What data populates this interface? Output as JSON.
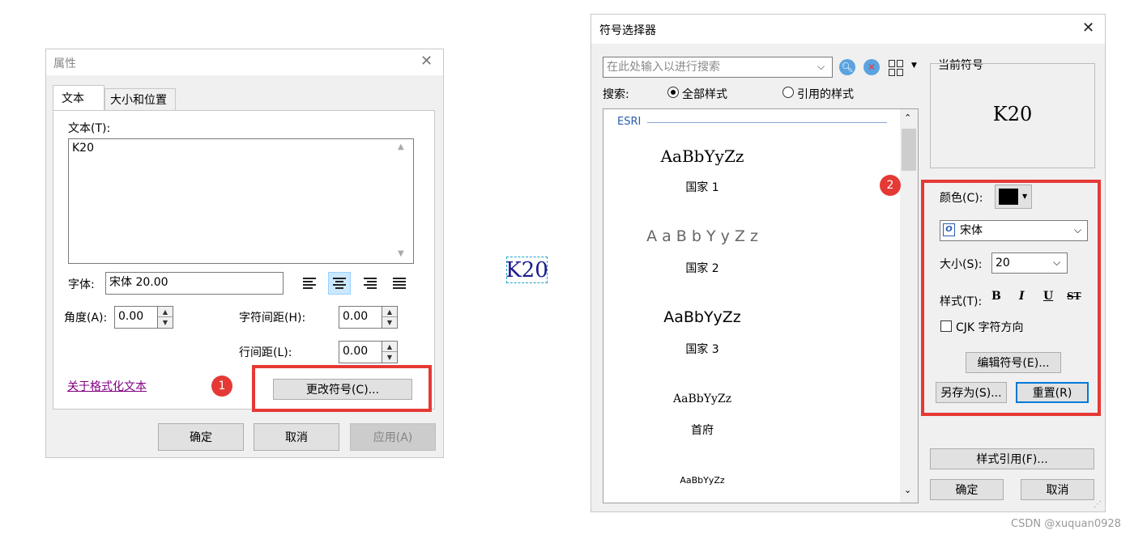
{
  "props": {
    "title": "属性",
    "tabs": [
      "文本",
      "大小和位置"
    ],
    "text_label": "文本(T):",
    "text_value": "K20",
    "font_label": "字体:",
    "font_value": "宋体 20.00",
    "angle_label": "角度(A):",
    "angle_value": "0.00",
    "char_spacing_label": "字符间距(H):",
    "char_spacing_value": "0.00",
    "line_spacing_label": "行间距(L):",
    "line_spacing_value": "0.00",
    "link": "关于格式化文本",
    "change_symbol": "更改符号(C)...",
    "ok": "确定",
    "cancel": "取消",
    "apply": "应用(A)",
    "badge": "1"
  },
  "preview_text": "K20",
  "selector": {
    "title": "符号选择器",
    "search_placeholder": "在此处输入以进行搜索",
    "search_label": "搜索:",
    "radio_all": "全部样式",
    "radio_ref": "引用的样式",
    "group_name": "ESRI",
    "styles": [
      {
        "sample": "AaBbYyZz",
        "name": "国家 1"
      },
      {
        "sample": "A a B b Y y Z z",
        "name": "国家 2"
      },
      {
        "sample": "AaBbYyZz",
        "name": "国家 3"
      },
      {
        "sample": "AaBbYyZz",
        "name": "首府"
      },
      {
        "sample": "AaBbYyZz",
        "name": ""
      }
    ],
    "current_symbol_label": "当前符号",
    "current_symbol_text": "K20",
    "color_label": "颜色(C):",
    "color_value": "#000000",
    "font_value": "宋体",
    "size_label": "大小(S):",
    "size_value": "20",
    "style_label": "样式(T):",
    "bold": "B",
    "italic": "I",
    "underline": "U",
    "strike": "ST",
    "cjk_label": "CJK 字符方向",
    "edit_symbol": "编辑符号(E)...",
    "save_as": "另存为(S)...",
    "reset": "重置(R)",
    "style_ref": "样式引用(F)...",
    "ok": "确定",
    "cancel": "取消",
    "badge": "2"
  },
  "watermark": "CSDN @xuquan0928",
  "colors": {
    "accent": "#0078d7",
    "highlight": "#e53935",
    "link": "#800080"
  }
}
